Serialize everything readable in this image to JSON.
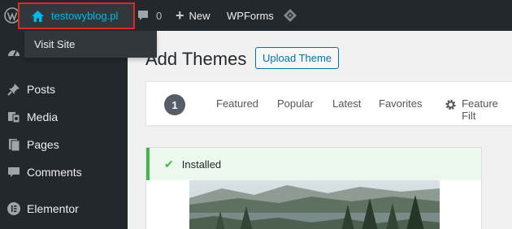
{
  "adminbar": {
    "site_name": "testowyblog.pl",
    "comments_count": "0",
    "new_label": "New",
    "wpforms_label": "WPForms"
  },
  "dropdown": {
    "visit_site": "Visit Site"
  },
  "sidebar": {
    "items": [
      {
        "label": "Posts",
        "icon": "pushpin-icon"
      },
      {
        "label": "Media",
        "icon": "media-icon"
      },
      {
        "label": "Pages",
        "icon": "pages-icon"
      },
      {
        "label": "Comments",
        "icon": "comment-icon"
      },
      {
        "label": "Elementor",
        "icon": "elementor-icon"
      }
    ]
  },
  "main": {
    "title": "Add Themes",
    "upload_button": "Upload Theme",
    "filter": {
      "count": "1",
      "tabs": [
        "Featured",
        "Popular",
        "Latest",
        "Favorites"
      ],
      "feature_filter": "Feature Filt"
    },
    "notice": "Installed"
  },
  "colors": {
    "adminbar_bg": "#23282d",
    "highlight_box": "#d62b2b",
    "link_blue": "#00b9eb",
    "success_green": "#46b450"
  }
}
